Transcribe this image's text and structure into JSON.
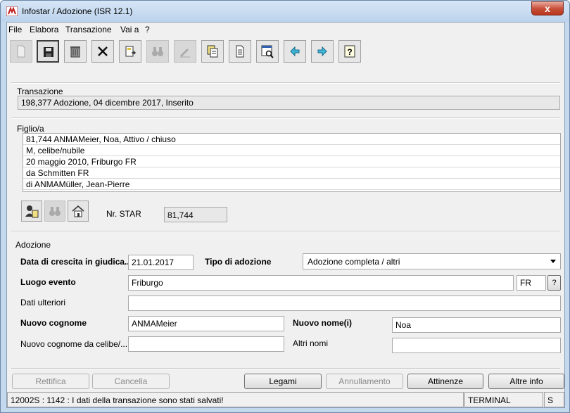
{
  "window": {
    "title": "Infostar / Adozione (ISR 12.1)",
    "close_label": "x"
  },
  "menu": [
    "File",
    "Elabora",
    "Transazione",
    "Vai a",
    "?"
  ],
  "toolbar": [
    {
      "icon": "new-document-icon",
      "enabled": false
    },
    {
      "icon": "save-icon",
      "enabled": true,
      "pressed": true
    },
    {
      "icon": "trash-icon",
      "enabled": true
    },
    {
      "icon": "delete-x-icon",
      "enabled": true
    },
    {
      "icon": "import-icon",
      "enabled": true
    },
    {
      "icon": "binoculars-icon",
      "enabled": false
    },
    {
      "icon": "edit-pen-icon",
      "enabled": false
    },
    {
      "icon": "copy-icon",
      "enabled": true
    },
    {
      "icon": "document-icon",
      "enabled": true
    },
    {
      "icon": "preview-icon",
      "enabled": true
    },
    {
      "icon": "arrow-left-icon",
      "enabled": true
    },
    {
      "icon": "arrow-right-icon",
      "enabled": true
    },
    {
      "icon": "help-icon",
      "enabled": true
    }
  ],
  "transazione": {
    "label": "Transazione",
    "value": "198,377  Adozione, 04 dicembre 2017, Inserito"
  },
  "figlio": {
    "label": "Figlio/a",
    "rows": [
      "81,744  ANMAMeier, Noa, Attivo / chiuso",
      "M, celibe/nubile",
      "20 maggio 2010, Friburgo FR",
      "da Schmitten FR",
      "di ANMAMüller, Jean-Pierre"
    ],
    "nr_star_label": "Nr. STAR",
    "nr_star_value": "81,744"
  },
  "adozione": {
    "label": "Adozione",
    "data_crescita_label": "Data di crescita in giudica...",
    "data_crescita_value": "21.01.2017",
    "tipo_label": "Tipo di adozione",
    "tipo_value": "Adozione completa / altri",
    "luogo_label": "Luogo evento",
    "luogo_value": "Friburgo",
    "luogo_cantone": "FR",
    "luogo_help": "?",
    "dati_label": "Dati ulteriori",
    "dati_value": "",
    "nuovo_cognome_label": "Nuovo cognome",
    "nuovo_cognome_value": "ANMAMeier",
    "nuovo_nome_label": "Nuovo nome(i)",
    "nuovo_nome_value": "Noa",
    "cognome_celibe_label": "Nuovo cognome da celibe/...",
    "cognome_celibe_value": "",
    "altri_nomi_label": "Altri nomi",
    "altri_nomi_value": ""
  },
  "buttons": {
    "rettifica": "Rettifica",
    "cancella": "Cancella",
    "legami": "Legami",
    "annullamento": "Annullamento",
    "attinenze": "Attinenze",
    "altre_info": "Altre info"
  },
  "status": {
    "message": "12002S : 1142 :  I dati della transazione sono stati salvati!",
    "terminal": "TERMINAL",
    "mode": "S"
  }
}
